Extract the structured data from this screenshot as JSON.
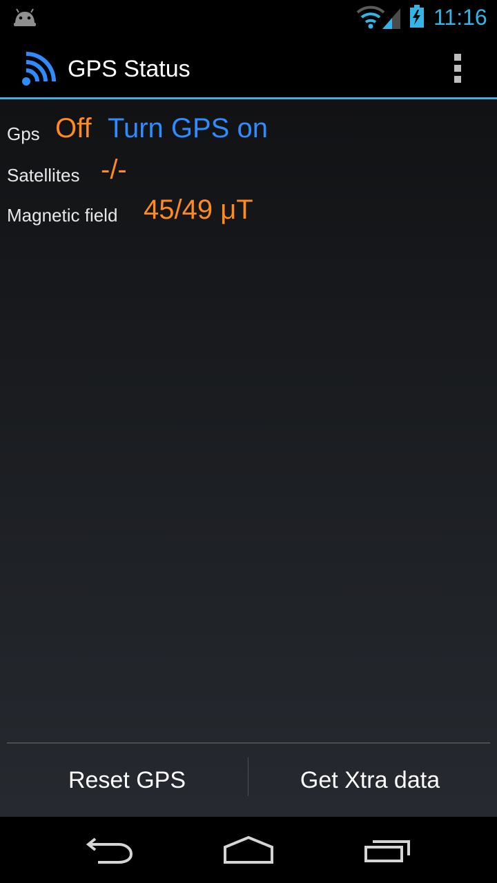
{
  "status_bar": {
    "time": "11:16",
    "icons": [
      "android-icon",
      "wifi-icon",
      "signal-icon",
      "battery-charging-icon"
    ]
  },
  "action_bar": {
    "title": "GPS Status",
    "app_icon": "gps-signal-icon",
    "overflow_icon": "overflow-menu-icon"
  },
  "gps": {
    "label": "Gps",
    "value": "Off",
    "action": "Turn GPS on"
  },
  "satellites": {
    "label": "Satellites",
    "value": "-/-"
  },
  "magnetic_field": {
    "label": "Magnetic field",
    "value": "45/49 μT"
  },
  "buttons": {
    "reset": "Reset GPS",
    "xtra": "Get Xtra data"
  },
  "nav_bar": {
    "icons": [
      "back-icon",
      "home-icon",
      "recent-apps-icon"
    ]
  },
  "colors": {
    "accent": "#33b5e5",
    "value": "#ff8a1f",
    "link": "#2f8cff"
  }
}
